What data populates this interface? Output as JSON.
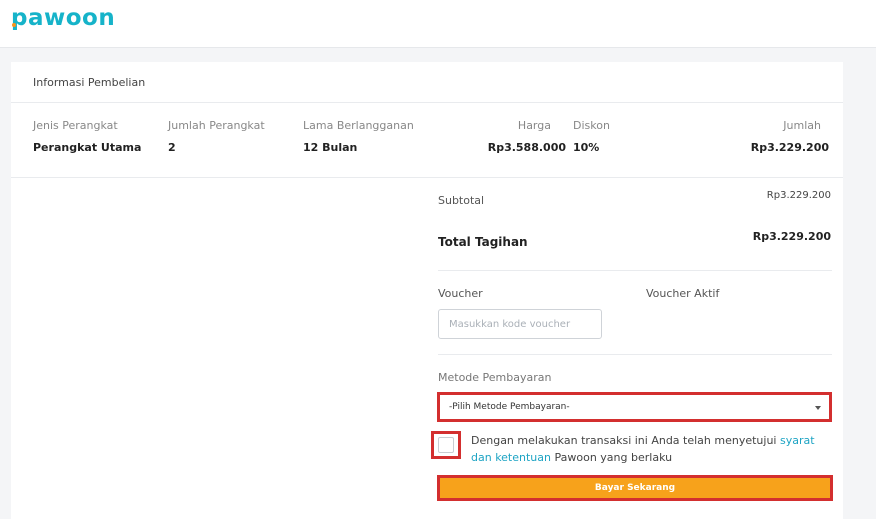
{
  "brand": {
    "name": "pawoon"
  },
  "purchase": {
    "title": "Informasi Pembelian",
    "headers": {
      "device_type": "Jenis Perangkat",
      "device_count": "Jumlah Perangkat",
      "duration": "Lama Berlangganan",
      "price": "Harga",
      "discount": "Diskon",
      "amount": "Jumlah"
    },
    "row": {
      "device_type": "Perangkat Utama",
      "device_count": "2",
      "duration": "12 Bulan",
      "price": "Rp3.588.000",
      "discount": "10%",
      "amount": "Rp3.229.200"
    }
  },
  "summary": {
    "subtotal_label": "Subtotal",
    "subtotal_value": "Rp3.229.200",
    "total_label": "Total Tagihan",
    "total_value": "Rp3.229.200"
  },
  "voucher": {
    "label": "Voucher",
    "active_label": "Voucher Aktif",
    "placeholder": "Masukkan kode voucher"
  },
  "payment": {
    "label": "Metode Pembayaran",
    "selected": "-Pilih Metode Pembayaran-"
  },
  "agreement": {
    "text_before": "Dengan melakukan transaksi ini Anda telah menyetujui ",
    "link": "syarat dan ketentuan",
    "text_after": " Pawoon yang berlaku"
  },
  "actions": {
    "pay_label": "Bayar Sekarang"
  },
  "colors": {
    "brand": "#16b3c9",
    "accent": "#f7a21b",
    "highlight": "#d32f2f",
    "link": "#1ea4c4"
  }
}
